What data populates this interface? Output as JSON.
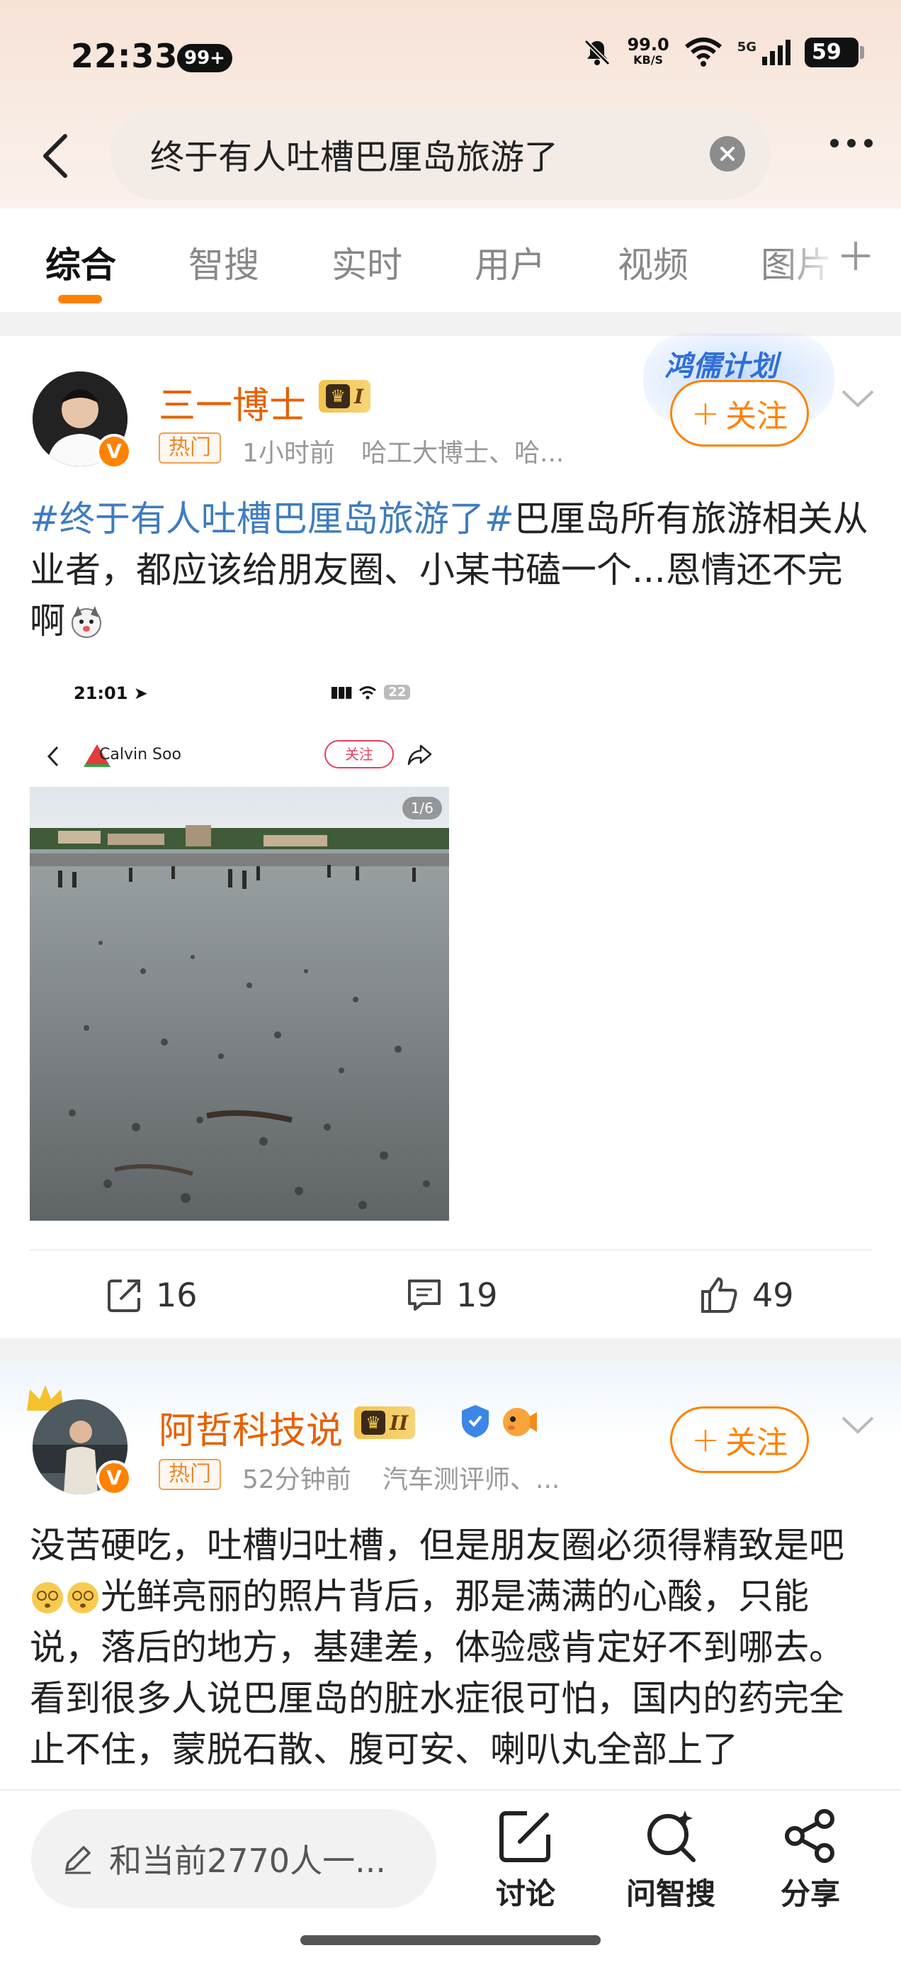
{
  "status_bar": {
    "time": "22:33",
    "notif_badge": "99+",
    "net_speed": "99.0",
    "net_unit": "KB/S",
    "signal": "5G",
    "battery": "59"
  },
  "search": {
    "query": "终于有人吐槽巴厘岛旅游了"
  },
  "tabs": [
    {
      "label": "综合"
    },
    {
      "label": "智搜"
    },
    {
      "label": "实时"
    },
    {
      "label": "用户"
    },
    {
      "label": "视频"
    },
    {
      "label": "图片"
    }
  ],
  "post1": {
    "user_name": "三一博士",
    "level": "I",
    "promo": "鸿儒计划",
    "hot_tag": "热门",
    "time": "1小时前",
    "desc": "哈工大博士、哈...",
    "follow_label": "关注",
    "hashtag": "#终于有人吐槽巴厘岛旅游了#",
    "text": "巴厘岛所有旅游相关从业者，都应该给朋友圈、小某书磕一个...恩情还不完啊",
    "shot": {
      "time": "21:01",
      "battery": "22",
      "user": "Calvin Soo",
      "follow": "关注",
      "counter": "1/6"
    },
    "reposts": "16",
    "comments": "19",
    "likes": "49"
  },
  "post2": {
    "user_name": "阿哲科技说",
    "level": "II",
    "hot_tag": "热门",
    "time": "52分钟前",
    "desc": "汽车测评师、...",
    "follow_label": "关注",
    "text_line1": "没苦硬吃，吐槽归吐槽，但是朋友圈必须得精致是吧",
    "text_line2": "光鲜亮丽的照片背后，那是满满的心酸，只能说，落后的地方，基建差，体验感肯定好不到哪去。",
    "text_line3": "看到很多人说巴厘岛的脏水症很可怕，国内的药完全止不住，蒙脱石散、腹可安、喇叭丸全部上了"
  },
  "bottom_bar": {
    "comment_placeholder": "和当前2770人一...",
    "discuss": "讨论",
    "ask": "问智搜",
    "share": "分享"
  }
}
